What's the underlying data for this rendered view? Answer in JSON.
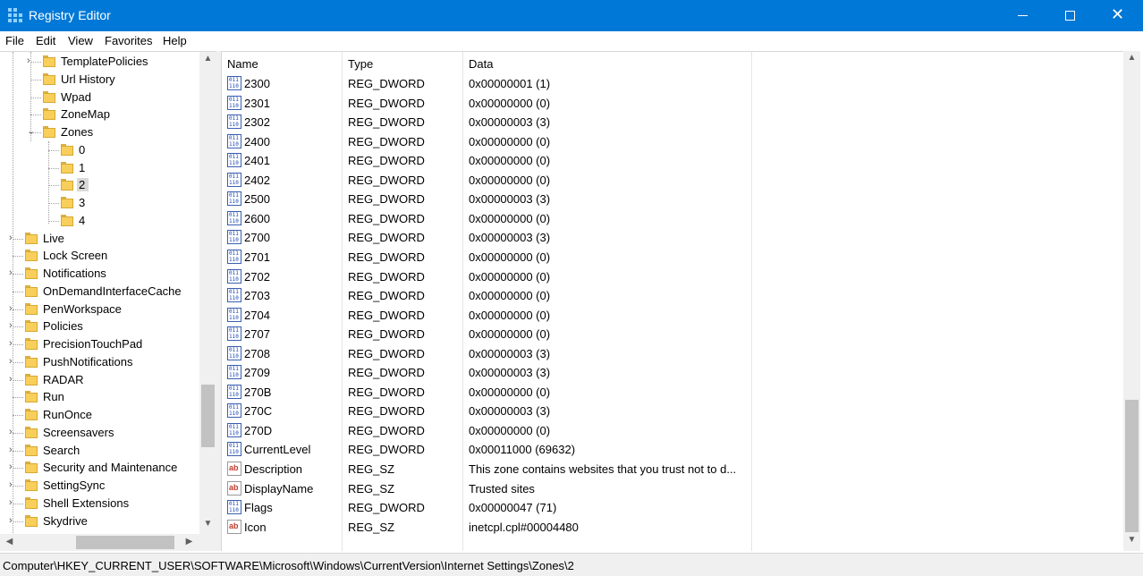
{
  "window": {
    "title": "Registry Editor"
  },
  "menu": [
    "File",
    "Edit",
    "View",
    "Favorites",
    "Help"
  ],
  "tree": [
    {
      "label": "TemplatePolicies",
      "expander": "›"
    },
    {
      "label": "Url History",
      "expander": ""
    },
    {
      "label": "Wpad",
      "expander": ""
    },
    {
      "label": "ZoneMap",
      "expander": ""
    },
    {
      "label": "Zones",
      "expander": "⌄"
    },
    {
      "label": "0",
      "expander": ""
    },
    {
      "label": "1",
      "expander": ""
    },
    {
      "label": "2",
      "expander": "",
      "selected": true
    },
    {
      "label": "3",
      "expander": ""
    },
    {
      "label": "4",
      "expander": ""
    },
    {
      "label": "Live",
      "expander": "›"
    },
    {
      "label": "Lock Screen",
      "expander": ""
    },
    {
      "label": "Notifications",
      "expander": "›"
    },
    {
      "label": "OnDemandInterfaceCache",
      "expander": ""
    },
    {
      "label": "PenWorkspace",
      "expander": "›"
    },
    {
      "label": "Policies",
      "expander": "›"
    },
    {
      "label": "PrecisionTouchPad",
      "expander": "›"
    },
    {
      "label": "PushNotifications",
      "expander": "›"
    },
    {
      "label": "RADAR",
      "expander": "›"
    },
    {
      "label": "Run",
      "expander": ""
    },
    {
      "label": "RunOnce",
      "expander": ""
    },
    {
      "label": "Screensavers",
      "expander": "›"
    },
    {
      "label": "Search",
      "expander": "›"
    },
    {
      "label": "Security and Maintenance",
      "expander": "›"
    },
    {
      "label": "SettingSync",
      "expander": "›"
    },
    {
      "label": "Shell Extensions",
      "expander": "›"
    },
    {
      "label": "Skydrive",
      "expander": "›"
    }
  ],
  "columns": {
    "name": "Name",
    "type": "Type",
    "data": "Data"
  },
  "values": [
    {
      "name": "2300",
      "type": "REG_DWORD",
      "data": "0x00000001 (1)",
      "icon": "binary"
    },
    {
      "name": "2301",
      "type": "REG_DWORD",
      "data": "0x00000000 (0)",
      "icon": "binary"
    },
    {
      "name": "2302",
      "type": "REG_DWORD",
      "data": "0x00000003 (3)",
      "icon": "binary"
    },
    {
      "name": "2400",
      "type": "REG_DWORD",
      "data": "0x00000000 (0)",
      "icon": "binary"
    },
    {
      "name": "2401",
      "type": "REG_DWORD",
      "data": "0x00000000 (0)",
      "icon": "binary"
    },
    {
      "name": "2402",
      "type": "REG_DWORD",
      "data": "0x00000000 (0)",
      "icon": "binary"
    },
    {
      "name": "2500",
      "type": "REG_DWORD",
      "data": "0x00000003 (3)",
      "icon": "binary"
    },
    {
      "name": "2600",
      "type": "REG_DWORD",
      "data": "0x00000000 (0)",
      "icon": "binary"
    },
    {
      "name": "2700",
      "type": "REG_DWORD",
      "data": "0x00000003 (3)",
      "icon": "binary"
    },
    {
      "name": "2701",
      "type": "REG_DWORD",
      "data": "0x00000000 (0)",
      "icon": "binary"
    },
    {
      "name": "2702",
      "type": "REG_DWORD",
      "data": "0x00000000 (0)",
      "icon": "binary"
    },
    {
      "name": "2703",
      "type": "REG_DWORD",
      "data": "0x00000000 (0)",
      "icon": "binary"
    },
    {
      "name": "2704",
      "type": "REG_DWORD",
      "data": "0x00000000 (0)",
      "icon": "binary"
    },
    {
      "name": "2707",
      "type": "REG_DWORD",
      "data": "0x00000000 (0)",
      "icon": "binary"
    },
    {
      "name": "2708",
      "type": "REG_DWORD",
      "data": "0x00000003 (3)",
      "icon": "binary"
    },
    {
      "name": "2709",
      "type": "REG_DWORD",
      "data": "0x00000003 (3)",
      "icon": "binary"
    },
    {
      "name": "270B",
      "type": "REG_DWORD",
      "data": "0x00000000 (0)",
      "icon": "binary"
    },
    {
      "name": "270C",
      "type": "REG_DWORD",
      "data": "0x00000003 (3)",
      "icon": "binary"
    },
    {
      "name": "270D",
      "type": "REG_DWORD",
      "data": "0x00000000 (0)",
      "icon": "binary"
    },
    {
      "name": "CurrentLevel",
      "type": "REG_DWORD",
      "data": "0x00011000 (69632)",
      "icon": "binary"
    },
    {
      "name": "Description",
      "type": "REG_SZ",
      "data": "This zone contains websites that you trust not to d...",
      "icon": "string"
    },
    {
      "name": "DisplayName",
      "type": "REG_SZ",
      "data": "Trusted sites",
      "icon": "string"
    },
    {
      "name": "Flags",
      "type": "REG_DWORD",
      "data": "0x00000047 (71)",
      "icon": "binary"
    },
    {
      "name": "Icon",
      "type": "REG_SZ",
      "data": "inetcpl.cpl#00004480",
      "icon": "string"
    }
  ],
  "status": {
    "path": "Computer\\HKEY_CURRENT_USER\\SOFTWARE\\Microsoft\\Windows\\CurrentVersion\\Internet Settings\\Zones\\2"
  },
  "colors": {
    "titlebar": "#0078d7",
    "folder": "#f8cf5a",
    "selection": "#d9d9d9"
  }
}
